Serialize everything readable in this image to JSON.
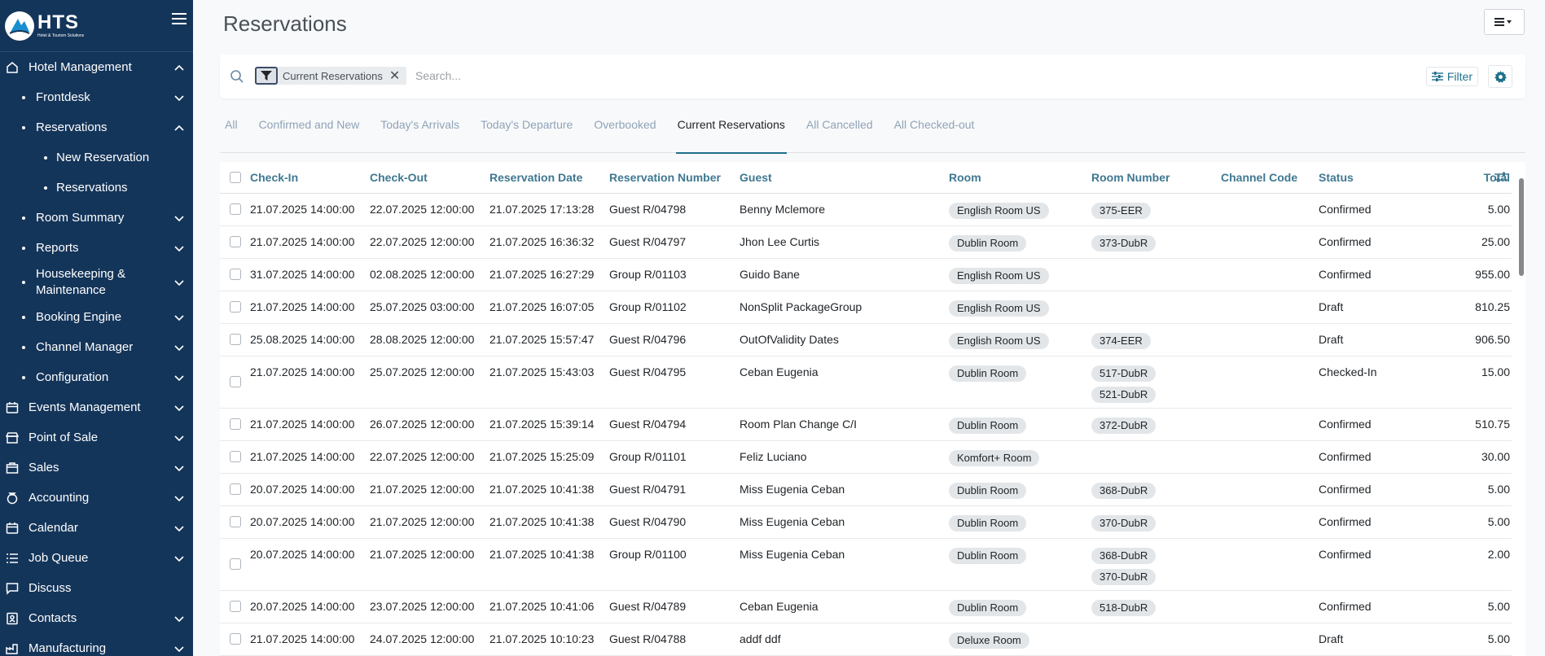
{
  "brand": {
    "name": "HTS",
    "tagline": "Hotel & Tourism Solutions"
  },
  "sidebar": {
    "items": [
      {
        "label": "Hotel Management",
        "level": 0,
        "icon": "hotel-icon",
        "chevron": "up"
      },
      {
        "label": "Frontdesk",
        "level": 1,
        "chevron": "down"
      },
      {
        "label": "Reservations",
        "level": 1,
        "chevron": "up"
      },
      {
        "label": "New Reservation",
        "level": 2
      },
      {
        "label": "Reservations",
        "level": 2
      },
      {
        "label": "Room Summary",
        "level": 1,
        "chevron": "down"
      },
      {
        "label": "Reports",
        "level": 1,
        "chevron": "down"
      },
      {
        "label": "Housekeeping & Maintenance",
        "level": 1,
        "chevron": "down"
      },
      {
        "label": "Booking Engine",
        "level": 1,
        "chevron": "down"
      },
      {
        "label": "Channel Manager",
        "level": 1,
        "chevron": "down"
      },
      {
        "label": "Configuration",
        "level": 1,
        "chevron": "down"
      },
      {
        "label": "Events Management",
        "level": 0,
        "icon": "calendar-icon",
        "chevron": "down"
      },
      {
        "label": "Point of Sale",
        "level": 0,
        "icon": "store-icon",
        "chevron": "down"
      },
      {
        "label": "Sales",
        "level": 0,
        "icon": "sales-icon",
        "chevron": "down"
      },
      {
        "label": "Accounting",
        "level": 0,
        "icon": "accounting-icon",
        "chevron": "down"
      },
      {
        "label": "Calendar",
        "level": 0,
        "icon": "calendar-icon",
        "chevron": "down"
      },
      {
        "label": "Job Queue",
        "level": 0,
        "icon": "list-icon",
        "chevron": "down"
      },
      {
        "label": "Discuss",
        "level": 0,
        "icon": "chat-icon"
      },
      {
        "label": "Contacts",
        "level": 0,
        "icon": "contacts-icon",
        "chevron": "down"
      },
      {
        "label": "Manufacturing",
        "level": 0,
        "icon": "manufacturing-icon",
        "chevron": "down"
      }
    ]
  },
  "header": {
    "title": "Reservations"
  },
  "search": {
    "facet": "Current Reservations",
    "facet_close": "✕",
    "placeholder": "Search...",
    "filter_label": "Filter"
  },
  "tabs": [
    {
      "label": "All",
      "active": false
    },
    {
      "label": "Confirmed and New",
      "active": false
    },
    {
      "label": "Today's Arrivals",
      "active": false
    },
    {
      "label": "Today's Departure",
      "active": false
    },
    {
      "label": "Overbooked",
      "active": false
    },
    {
      "label": "Current Reservations",
      "active": true
    },
    {
      "label": "All Cancelled",
      "active": false
    },
    {
      "label": "All Checked-out",
      "active": false
    }
  ],
  "table": {
    "columns": [
      "Check-In",
      "Check-Out",
      "Reservation Date",
      "Reservation Number",
      "Guest",
      "Room",
      "Room Number",
      "Channel Code",
      "Status",
      "Total"
    ],
    "rows": [
      {
        "check_in": "21.07.2025 14:00:00",
        "check_out": "22.07.2025 12:00:00",
        "res_date": "21.07.2025 17:13:28",
        "res_number": "Guest R/04798",
        "guest": "Benny Mclemore",
        "room": "English Room US",
        "room_numbers": [
          "375-EER"
        ],
        "channel": "",
        "status": "Confirmed",
        "total": "5.00"
      },
      {
        "check_in": "21.07.2025 14:00:00",
        "check_out": "22.07.2025 12:00:00",
        "res_date": "21.07.2025 16:36:32",
        "res_number": "Guest R/04797",
        "guest": "Jhon Lee Curtis",
        "room": "Dublin Room",
        "room_numbers": [
          "373-DubR"
        ],
        "channel": "",
        "status": "Confirmed",
        "total": "25.00"
      },
      {
        "check_in": "31.07.2025 14:00:00",
        "check_out": "02.08.2025 12:00:00",
        "res_date": "21.07.2025 16:27:29",
        "res_number": "Group R/01103",
        "guest": "Guido Bane",
        "room": "English Room US",
        "room_numbers": [],
        "channel": "",
        "status": "Confirmed",
        "total": "955.00"
      },
      {
        "check_in": "21.07.2025 14:00:00",
        "check_out": "25.07.2025 03:00:00",
        "res_date": "21.07.2025 16:07:05",
        "res_number": "Group R/01102",
        "guest": "NonSplit PackageGroup",
        "room": "English Room US",
        "room_numbers": [],
        "channel": "",
        "status": "Draft",
        "total": "810.25"
      },
      {
        "check_in": "25.08.2025 14:00:00",
        "check_out": "28.08.2025 12:00:00",
        "res_date": "21.07.2025 15:57:47",
        "res_number": "Guest R/04796",
        "guest": "OutOfValidity Dates",
        "room": "English Room US",
        "room_numbers": [
          "374-EER"
        ],
        "channel": "",
        "status": "Draft",
        "total": "906.50"
      },
      {
        "check_in": "21.07.2025 14:00:00",
        "check_out": "25.07.2025 12:00:00",
        "res_date": "21.07.2025 15:43:03",
        "res_number": "Guest R/04795",
        "guest": "Ceban Eugenia",
        "room": "Dublin Room",
        "room_numbers": [
          "517-DubR",
          "521-DubR"
        ],
        "channel": "",
        "status": "Checked-In",
        "total": "15.00"
      },
      {
        "check_in": "21.07.2025 14:00:00",
        "check_out": "26.07.2025 12:00:00",
        "res_date": "21.07.2025 15:39:14",
        "res_number": "Guest R/04794",
        "guest": "Room Plan Change C/I",
        "room": "Dublin Room",
        "room_numbers": [
          "372-DubR"
        ],
        "channel": "",
        "status": "Confirmed",
        "total": "510.75"
      },
      {
        "check_in": "21.07.2025 14:00:00",
        "check_out": "22.07.2025 12:00:00",
        "res_date": "21.07.2025 15:25:09",
        "res_number": "Group R/01101",
        "guest": "Feliz Luciano",
        "room": "Komfort+ Room",
        "room_numbers": [],
        "channel": "",
        "status": "Confirmed",
        "total": "30.00"
      },
      {
        "check_in": "20.07.2025 14:00:00",
        "check_out": "21.07.2025 12:00:00",
        "res_date": "21.07.2025 10:41:38",
        "res_number": "Guest R/04791",
        "guest": "Miss Eugenia Ceban",
        "room": "Dublin Room",
        "room_numbers": [
          "368-DubR"
        ],
        "channel": "",
        "status": "Confirmed",
        "total": "5.00"
      },
      {
        "check_in": "20.07.2025 14:00:00",
        "check_out": "21.07.2025 12:00:00",
        "res_date": "21.07.2025 10:41:38",
        "res_number": "Guest R/04790",
        "guest": "Miss Eugenia Ceban",
        "room": "Dublin Room",
        "room_numbers": [
          "370-DubR"
        ],
        "channel": "",
        "status": "Confirmed",
        "total": "5.00"
      },
      {
        "check_in": "20.07.2025 14:00:00",
        "check_out": "21.07.2025 12:00:00",
        "res_date": "21.07.2025 10:41:38",
        "res_number": "Group R/01100",
        "guest": "Miss Eugenia Ceban",
        "room": "Dublin Room",
        "room_numbers": [
          "368-DubR",
          "370-DubR"
        ],
        "channel": "",
        "status": "Confirmed",
        "total": "2.00"
      },
      {
        "check_in": "20.07.2025 14:00:00",
        "check_out": "23.07.2025 12:00:00",
        "res_date": "21.07.2025 10:41:06",
        "res_number": "Guest R/04789",
        "guest": "Ceban Eugenia",
        "room": "Dublin Room",
        "room_numbers": [
          "518-DubR"
        ],
        "channel": "",
        "status": "Confirmed",
        "total": "5.00"
      },
      {
        "check_in": "21.07.2025 14:00:00",
        "check_out": "24.07.2025 12:00:00",
        "res_date": "21.07.2025 10:10:23",
        "res_number": "Guest R/04788",
        "guest": "addf ddf",
        "room": "Deluxe Room",
        "room_numbers": [],
        "channel": "",
        "status": "Draft",
        "total": "5.00"
      }
    ]
  },
  "colors": {
    "sidebar_bg": "#14355a",
    "accent": "#1f6f8b",
    "header_text": "#3f7891"
  }
}
